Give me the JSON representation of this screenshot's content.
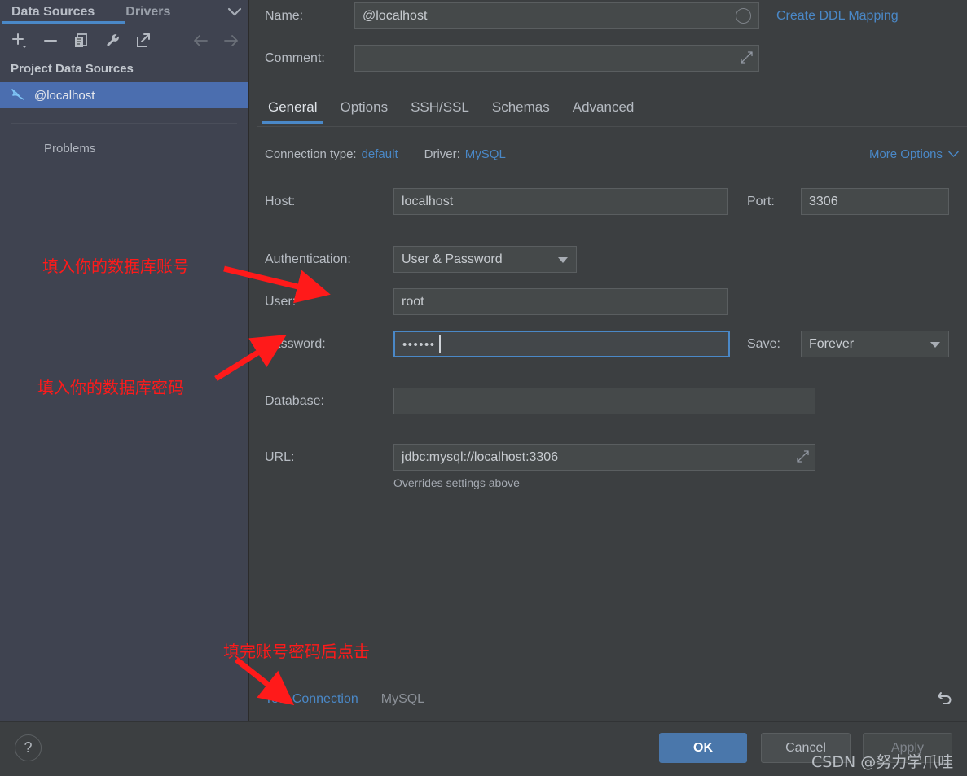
{
  "sidebar": {
    "tabs": [
      {
        "label": "Data Sources",
        "active": true
      },
      {
        "label": "Drivers",
        "active": false
      }
    ],
    "chevron_icon": "chevron-down-icon",
    "toolbar_icons": [
      "add-icon",
      "remove-icon",
      "duplicate-icon",
      "wrench-icon",
      "export-icon",
      "back-arrow-icon",
      "forward-arrow-icon"
    ],
    "group_label": "Project Data Sources",
    "datasource": {
      "label": "@localhost",
      "icon": "mysql-dolphin-icon",
      "selected": true
    },
    "problems_label": "Problems"
  },
  "form": {
    "name_label": "Name:",
    "name_value": "@localhost",
    "create_ddl_link": "Create DDL Mapping",
    "comment_label": "Comment:",
    "comment_value": "",
    "tabs": [
      {
        "label": "General",
        "active": true
      },
      {
        "label": "Options",
        "active": false
      },
      {
        "label": "SSH/SSL",
        "active": false
      },
      {
        "label": "Schemas",
        "active": false
      },
      {
        "label": "Advanced",
        "active": false
      }
    ],
    "connection_type_label": "Connection type:",
    "connection_type_value": "default",
    "driver_label": "Driver:",
    "driver_value": "MySQL",
    "more_options_label": "More Options",
    "host_label": "Host:",
    "host_value": "localhost",
    "port_label": "Port:",
    "port_value": "3306",
    "authentication_label": "Authentication:",
    "authentication_value": "User & Password",
    "user_label": "User:",
    "user_value": "root",
    "password_label": "Password:",
    "password_value": "••••••",
    "save_label": "Save:",
    "save_value": "Forever",
    "database_label": "Database:",
    "database_value": "",
    "url_label": "URL:",
    "url_value": "jdbc:mysql://localhost:3306",
    "url_hint": "Overrides settings above",
    "test_connection_label": "Test Connection",
    "driver_footer_label": "MySQL",
    "revert_icon": "revert-icon"
  },
  "buttons": {
    "help_label": "?",
    "ok_label": "OK",
    "cancel_label": "Cancel",
    "apply_label": "Apply"
  },
  "annotations": [
    {
      "text": "填入你的数据库账号"
    },
    {
      "text": "填入你的数据库密码"
    },
    {
      "text": "填完账号密码后点击"
    }
  ],
  "watermark": "CSDN @努力学爪哇",
  "colors": {
    "accent_blue": "#4a88c7",
    "selection_blue": "#4b6eaf",
    "panel_bg": "#3c3f41",
    "sidebar_bg": "#3f4350",
    "field_bg": "#45494a",
    "annotation_red": "#ff1a1a",
    "ok_button": "#4a77ab"
  }
}
